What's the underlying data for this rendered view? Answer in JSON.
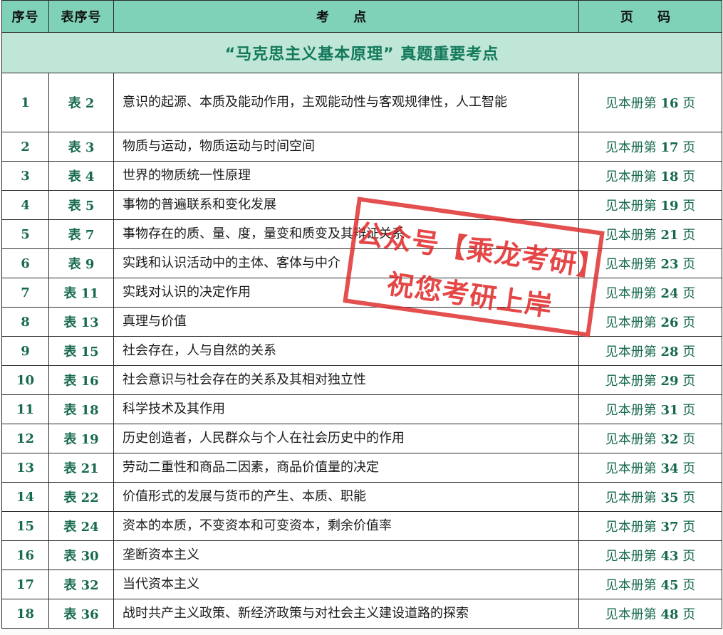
{
  "header": {
    "col_num": "序号",
    "col_table": "表序号",
    "col_topic": "考 点",
    "col_page": "页 码"
  },
  "section_title": "“马克思主义基本原理” 真题重要考点",
  "rows": [
    {
      "num": "1",
      "table": "表 2",
      "topic": "意识的起源、本质及能动作用，主观能动性与客观规律性，人工智能",
      "page_prefix": "见本册第",
      "page_num": "16",
      "page_suffix": "页"
    },
    {
      "num": "2",
      "table": "表 3",
      "topic": "物质与运动，物质运动与时间空间",
      "page_prefix": "见本册第",
      "page_num": "17",
      "page_suffix": "页"
    },
    {
      "num": "3",
      "table": "表 4",
      "topic": "世界的物质统一性原理",
      "page_prefix": "见本册第",
      "page_num": "18",
      "page_suffix": "页"
    },
    {
      "num": "4",
      "table": "表 5",
      "topic": "事物的普遍联系和变化发展",
      "page_prefix": "见本册第",
      "page_num": "19",
      "page_suffix": "页"
    },
    {
      "num": "5",
      "table": "表 7",
      "topic": "事物存在的质、量、度，量变和质变及其辩证关系",
      "page_prefix": "见本册第",
      "page_num": "21",
      "page_suffix": "页"
    },
    {
      "num": "6",
      "table": "表 9",
      "topic": "实践和认识活动中的主体、客体与中介",
      "page_prefix": "见本册第",
      "page_num": "23",
      "page_suffix": "页"
    },
    {
      "num": "7",
      "table": "表 11",
      "topic": "实践对认识的决定作用",
      "page_prefix": "见本册第",
      "page_num": "24",
      "page_suffix": "页"
    },
    {
      "num": "8",
      "table": "表 13",
      "topic": "真理与价值",
      "page_prefix": "见本册第",
      "page_num": "26",
      "page_suffix": "页"
    },
    {
      "num": "9",
      "table": "表 15",
      "topic": "社会存在，人与自然的关系",
      "page_prefix": "见本册第",
      "page_num": "28",
      "page_suffix": "页"
    },
    {
      "num": "10",
      "table": "表 16",
      "topic": "社会意识与社会存在的关系及其相对独立性",
      "page_prefix": "见本册第",
      "page_num": "29",
      "page_suffix": "页"
    },
    {
      "num": "11",
      "table": "表 18",
      "topic": "科学技术及其作用",
      "page_prefix": "见本册第",
      "page_num": "31",
      "page_suffix": "页"
    },
    {
      "num": "12",
      "table": "表 19",
      "topic": "历史创造者，人民群众与个人在社会历史中的作用",
      "page_prefix": "见本册第",
      "page_num": "32",
      "page_suffix": "页"
    },
    {
      "num": "13",
      "table": "表 21",
      "topic": "劳动二重性和商品二因素，商品价值量的决定",
      "page_prefix": "见本册第",
      "page_num": "34",
      "page_suffix": "页"
    },
    {
      "num": "14",
      "table": "表 22",
      "topic": "价值形式的发展与货币的产生、本质、职能",
      "page_prefix": "见本册第",
      "page_num": "35",
      "page_suffix": "页"
    },
    {
      "num": "15",
      "table": "表 24",
      "topic": "资本的本质，不变资本和可变资本，剩余价值率",
      "page_prefix": "见本册第",
      "page_num": "37",
      "page_suffix": "页"
    },
    {
      "num": "16",
      "table": "表 30",
      "topic": "垄断资本主义",
      "page_prefix": "见本册第",
      "page_num": "43",
      "page_suffix": "页"
    },
    {
      "num": "17",
      "table": "表 32",
      "topic": "当代资本主义",
      "page_prefix": "见本册第",
      "page_num": "45",
      "page_suffix": "页"
    },
    {
      "num": "18",
      "table": "表 36",
      "topic": "战时共产主义政策、新经济政策与对社会主义建设道路的探索",
      "page_prefix": "见本册第",
      "page_num": "48",
      "page_suffix": "页"
    }
  ],
  "stamp": {
    "line1": "公众号【乘龙考研】",
    "line2": "祝您考研上岸",
    "color": "#de2828"
  },
  "colors": {
    "header_bg": "#7fd2b8",
    "section_bg": "#bfe6d6",
    "accent_text": "#176a4d"
  }
}
